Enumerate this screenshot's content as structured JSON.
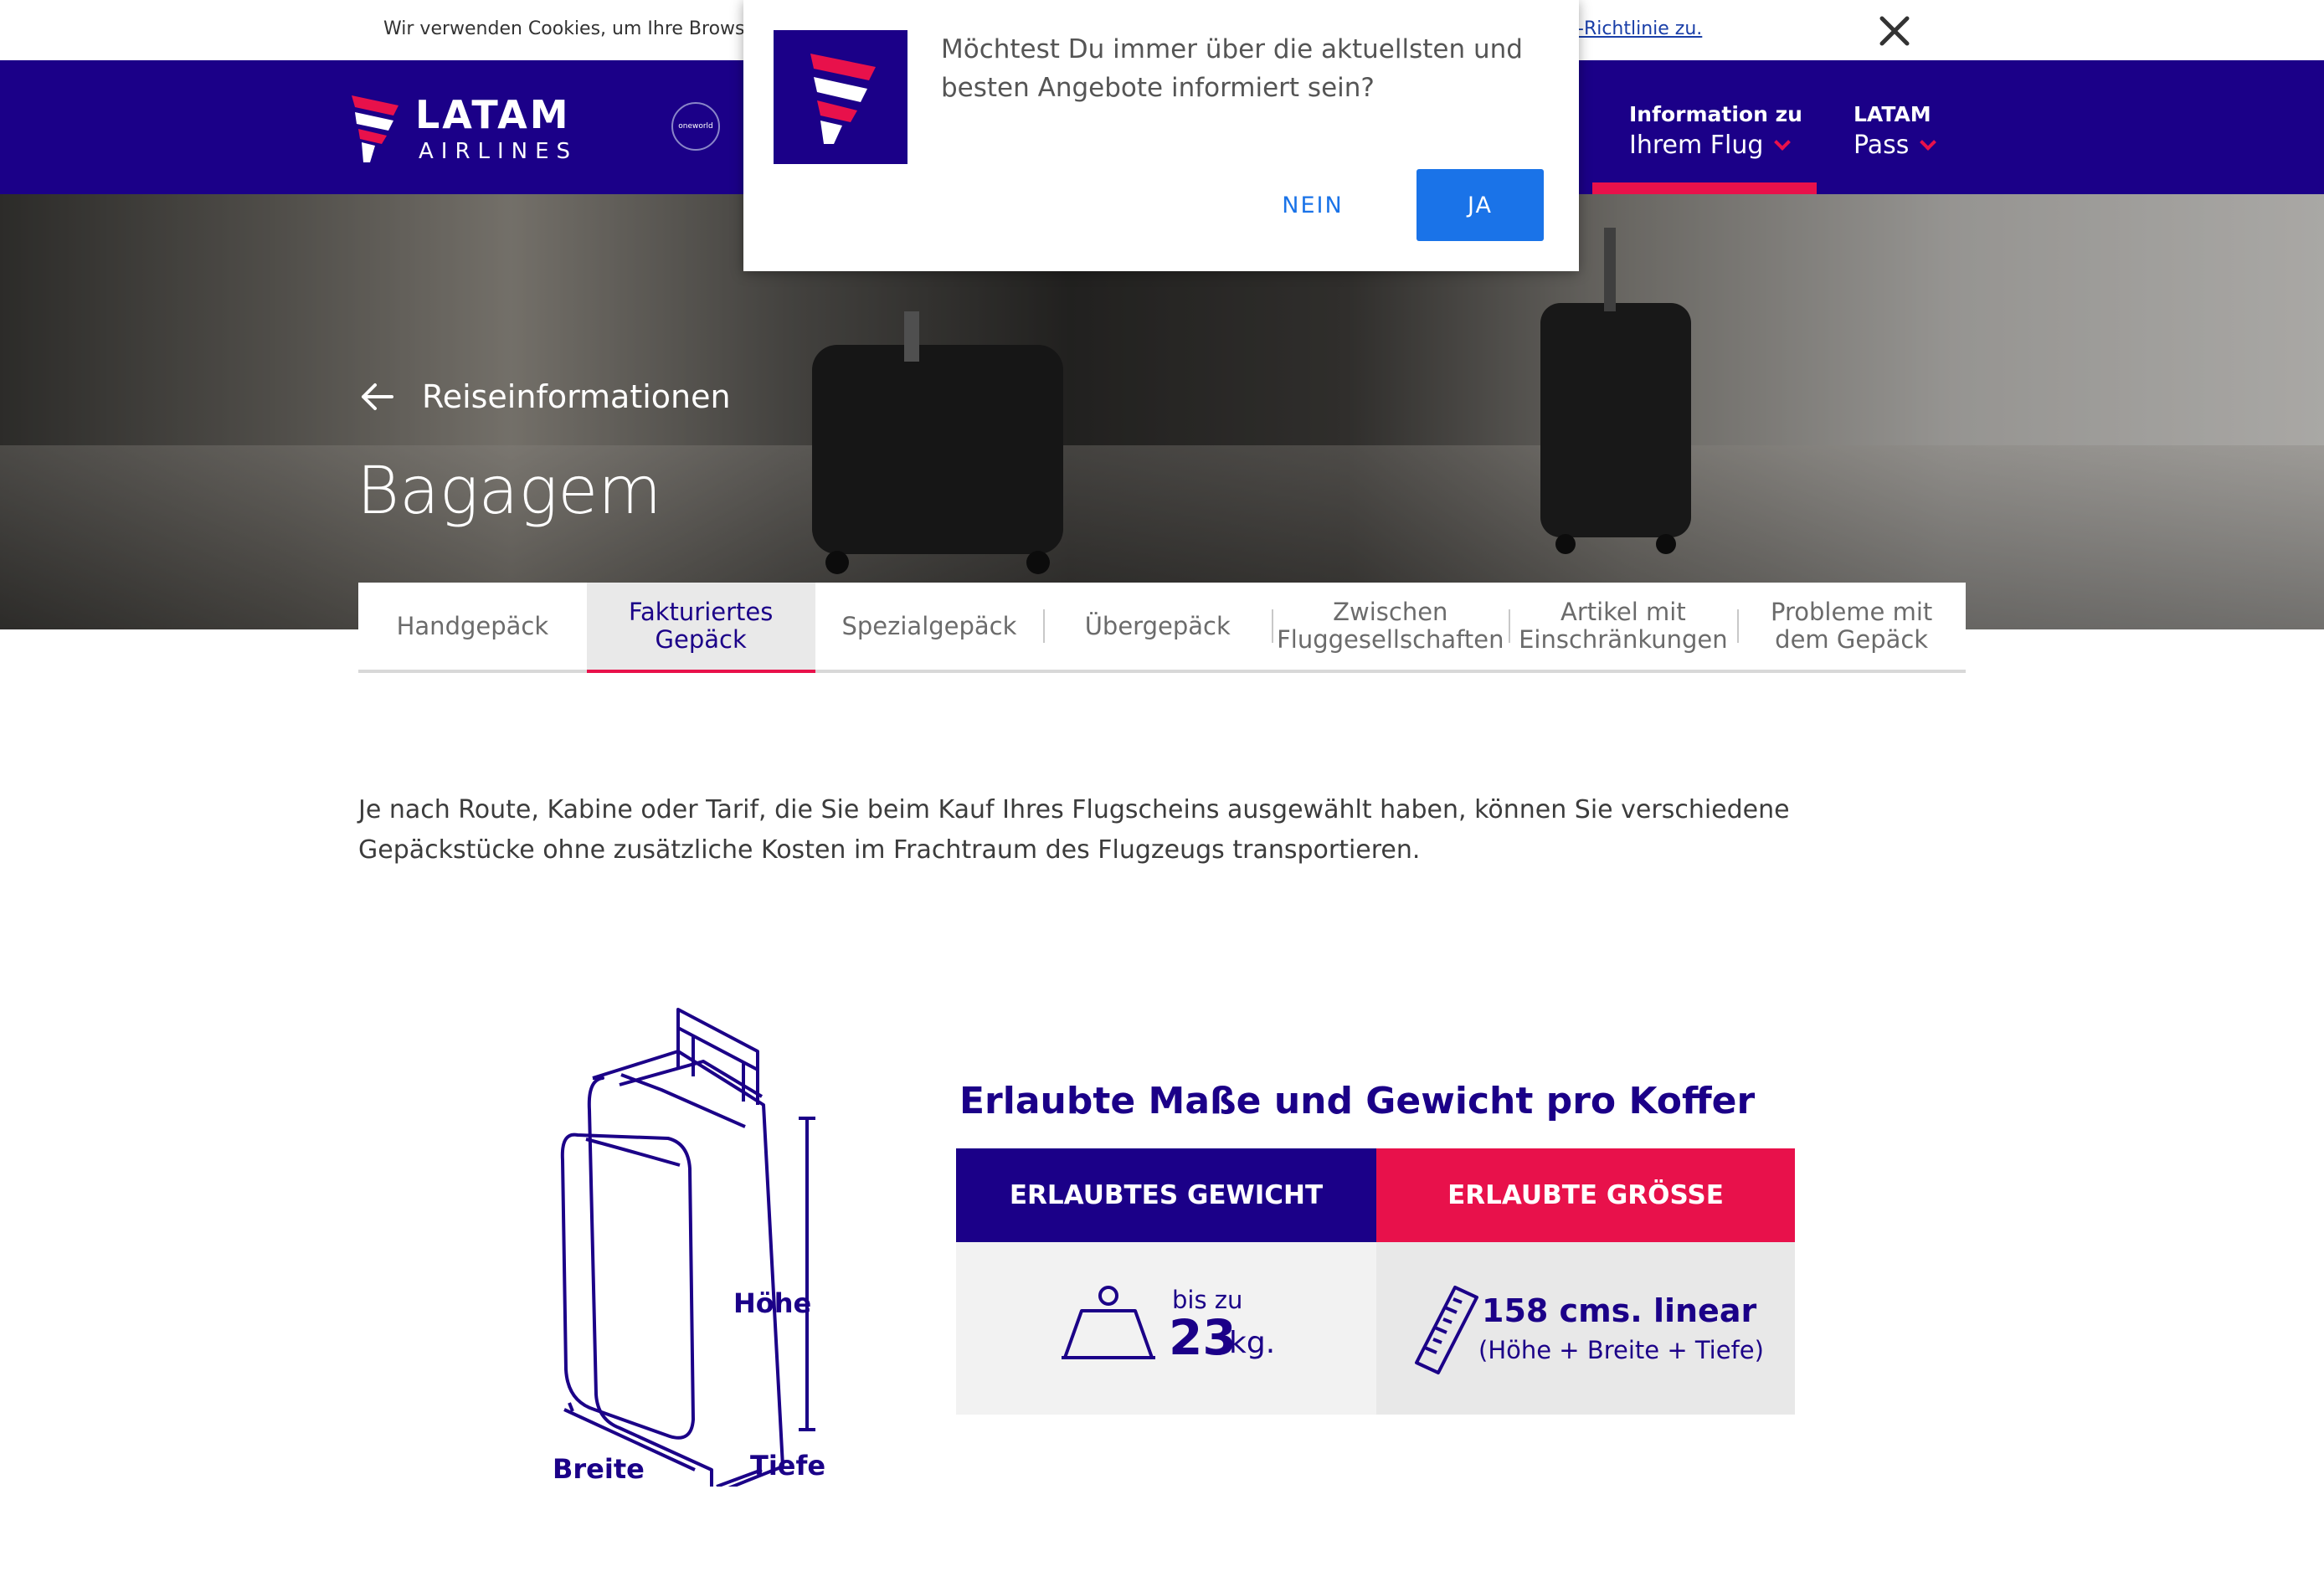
{
  "cookie": {
    "text": "Wir verwenden Cookies, um Ihre Browser-",
    "link": "-Richtlinie zu."
  },
  "header": {
    "logo_word": "LATAM",
    "logo_sub": "AIRLINES",
    "alliance": "oneworld",
    "nav": [
      {
        "top": "Information zu",
        "bottom": "Ihrem Flug"
      },
      {
        "top": "LATAM",
        "bottom": "Pass"
      }
    ]
  },
  "hero": {
    "breadcrumb": "Reiseinformationen",
    "title": "Bagagem"
  },
  "tabs": [
    "Handgepäck",
    "Fakturiertes Gepäck",
    "Spezialgepäck",
    "Übergepäck",
    "Zwischen Fluggesellschaften",
    "Artikel mit Einschränkungen",
    "Probleme mit dem Gepäck"
  ],
  "active_tab": "Fakturiertes Gepäck",
  "intro": "Je nach Route, Kabine oder Tarif, die Sie beim Kauf Ihres Flugscheins ausgewählt haben, können Sie verschiedene Gepäckstücke ohne zusätzliche Kosten im Frachtraum des Flugzeugs transportieren.",
  "infographic": {
    "title": "Erlaubte Maße und Gewicht pro Koffer",
    "dims": {
      "height": "Höhe",
      "width": "Breite",
      "depth": "Tiefe"
    },
    "weight_header": "ERLAUBTES GEWICHT",
    "size_header": "ERLAUBTE GRÖSSE",
    "weight_prefix": "bis zu",
    "weight_value": "23",
    "weight_unit": "kg.",
    "size_value": "158 cms. linear",
    "size_note": "(Höhe + Breite + Tiefe)"
  },
  "prompt": {
    "text": "Möchtest Du immer über die aktuellsten und besten Angebote informiert sein?",
    "no": "NEIN",
    "yes": "JA"
  },
  "colors": {
    "brand": "#1b0088",
    "accent": "#e8114b",
    "prompt_button": "#1a73e8"
  },
  "icons": [
    "close-icon",
    "back-arrow-icon",
    "chevron-down-icon",
    "scale-weight-icon",
    "ruler-icon",
    "suitcase-illustration"
  ]
}
